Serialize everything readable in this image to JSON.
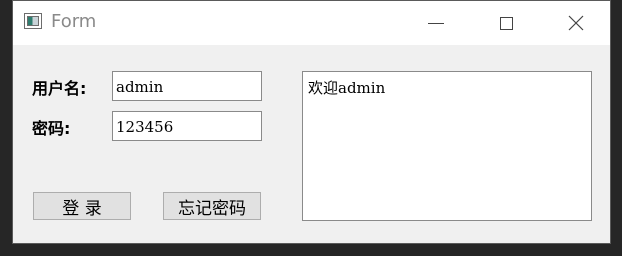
{
  "window": {
    "title": "Form",
    "app_icon": "form-window-icon",
    "controls": {
      "minimize_icon": "minimize-icon",
      "maximize_icon": "maximize-icon",
      "close_icon": "close-icon"
    }
  },
  "form": {
    "username_label": "用户名:",
    "username_value": "admin",
    "password_label": "密码:",
    "password_value": "123456",
    "login_button_label": "登 录",
    "forgot_button_label": "忘记密码"
  },
  "output": {
    "text": "欢迎admin"
  }
}
